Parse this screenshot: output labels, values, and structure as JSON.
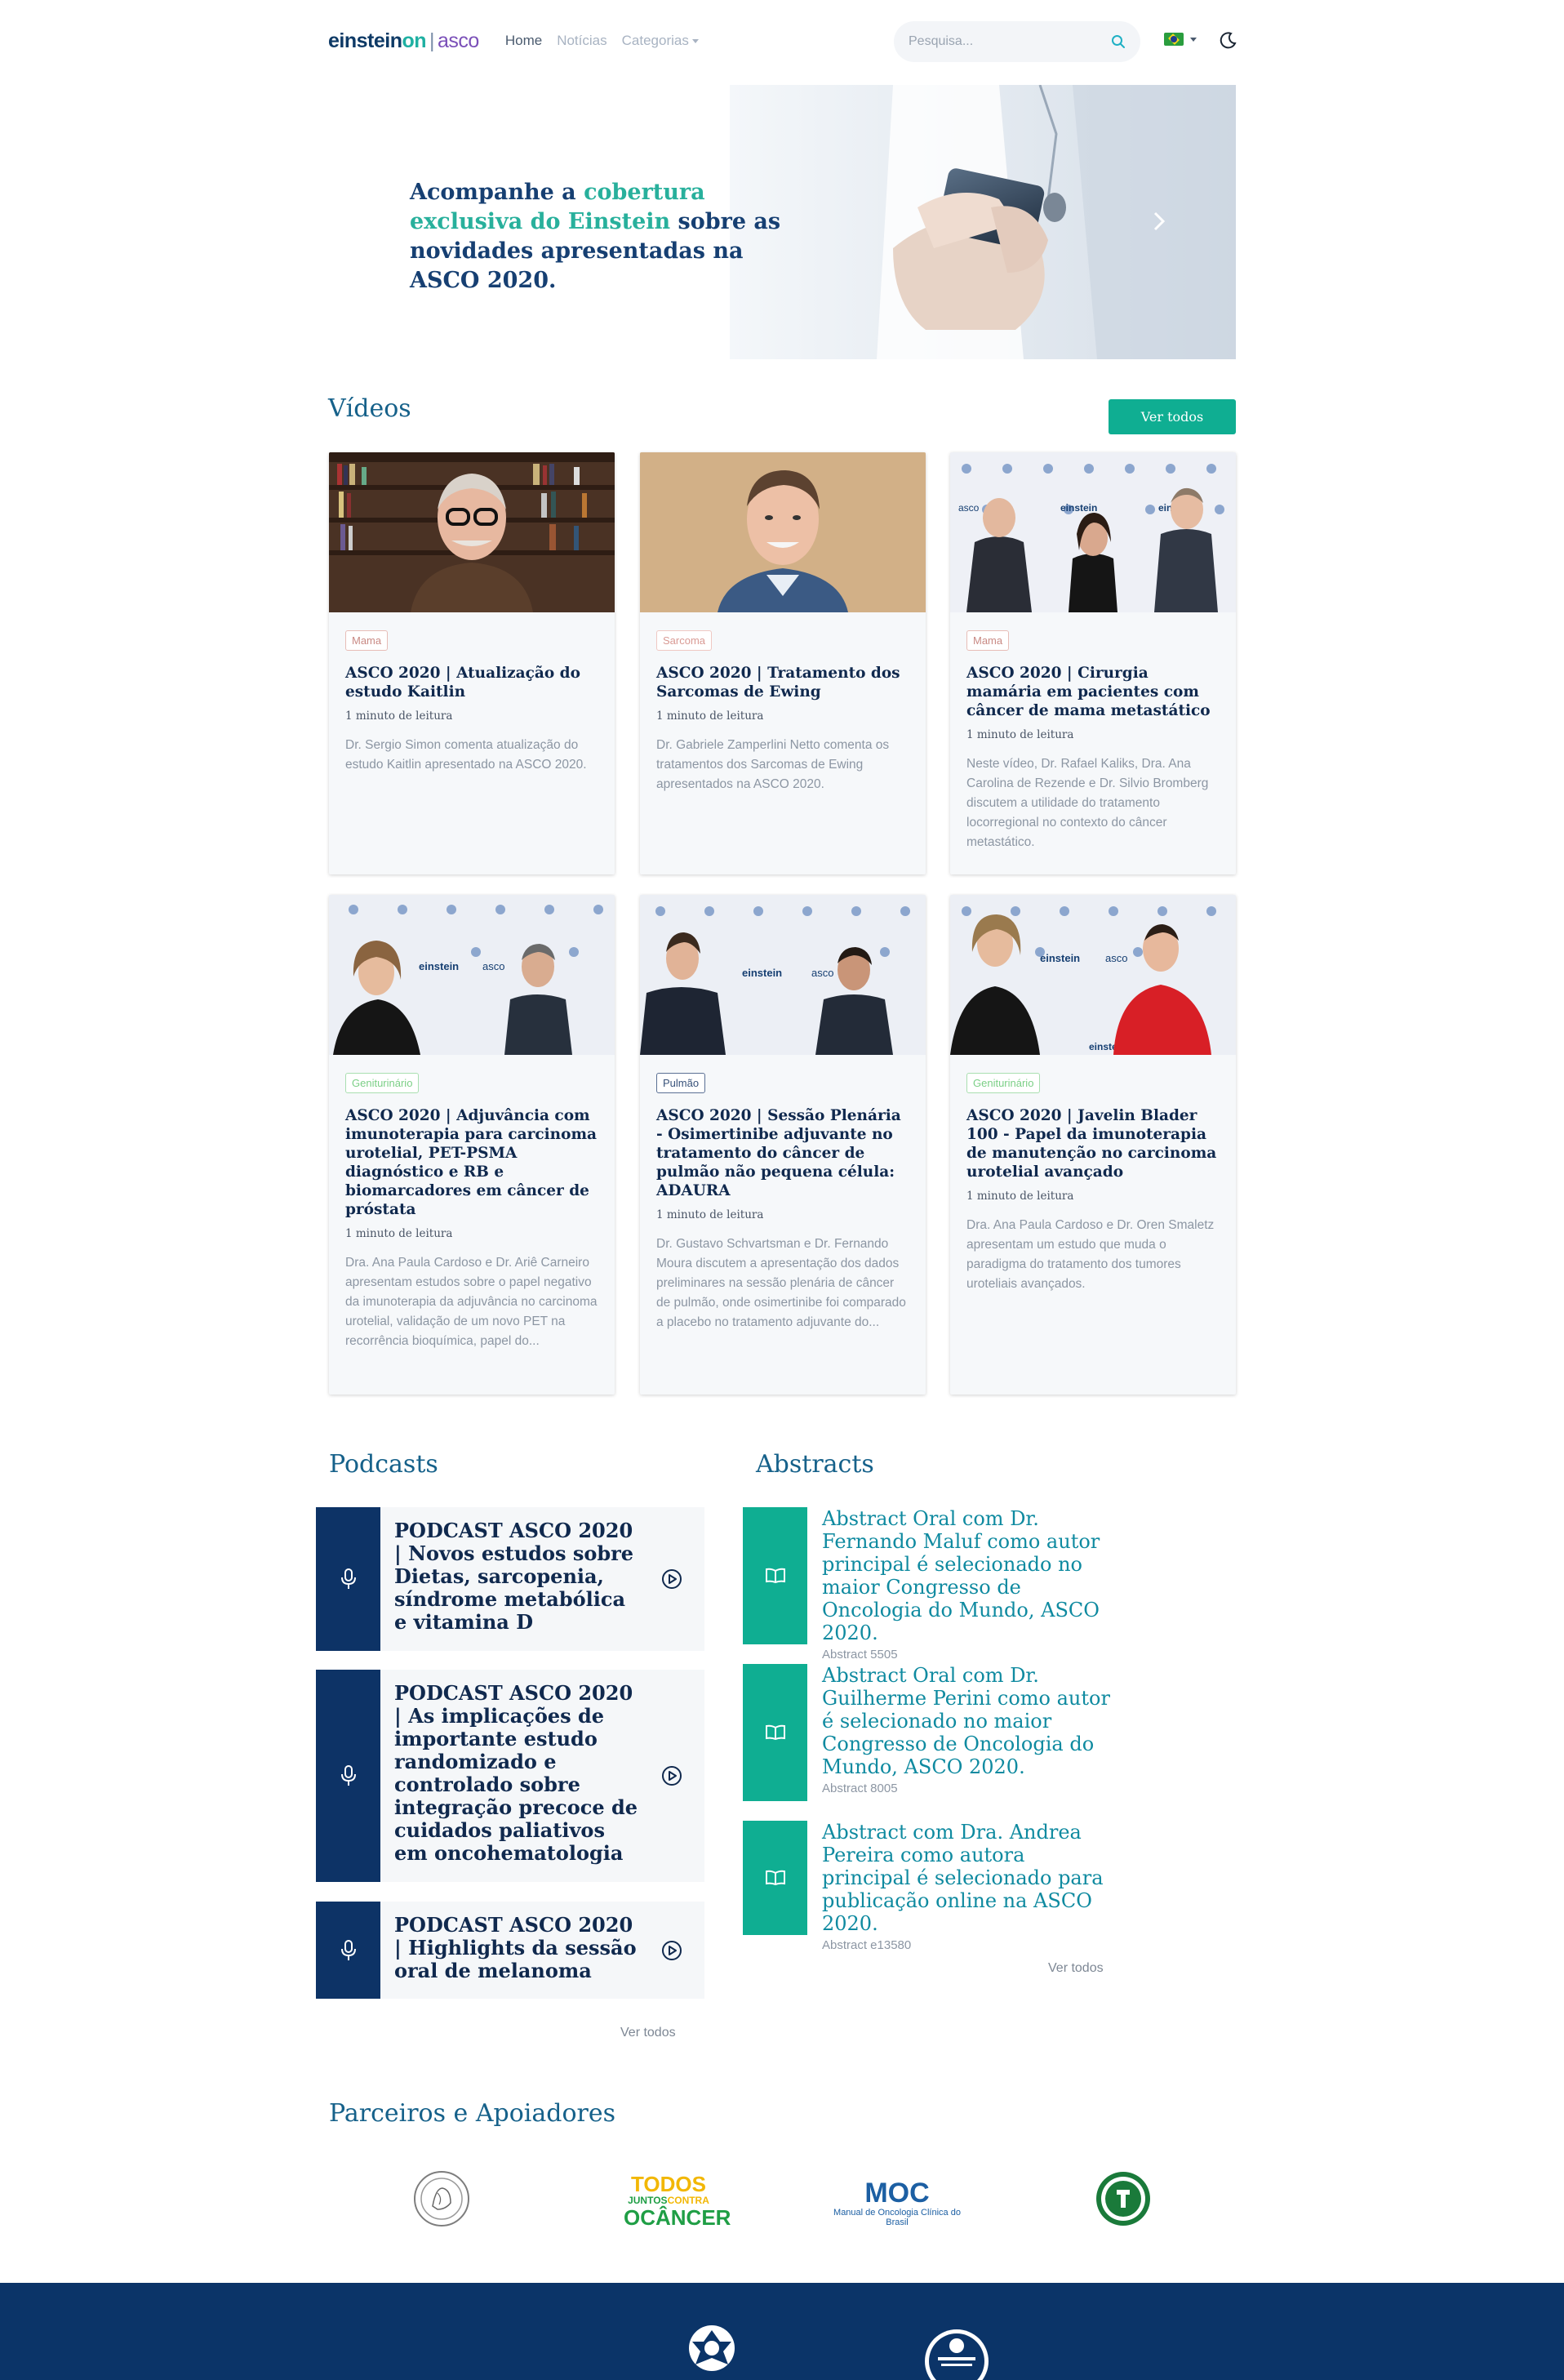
{
  "nav": {
    "logo": {
      "part1": "einstein",
      "part2": "on",
      "separator": "|",
      "part3": "asco"
    },
    "links": [
      "Home",
      "Notícias",
      "Categorias"
    ],
    "search_placeholder": "Pesquisa...",
    "language_icon": "brazil-flag-icon",
    "theme_icon": "moon-icon"
  },
  "hero": {
    "text_before": "Acompanhe a ",
    "text_highlight": "cobertura exclusiva do Einstein",
    "text_after": " sobre as novidades apresentadas na ASCO 2020."
  },
  "videos": {
    "title": "Vídeos",
    "see_all": "Ver todos",
    "items": [
      {
        "tag": "Mama",
        "title": "ASCO 2020 | Atualização do estudo Kaitlin",
        "read": "1 minuto de leitura",
        "desc": "Dr. Sergio Simon comenta atualização do estudo Kaitlin apresentado na ASCO 2020."
      },
      {
        "tag": "Sarcoma",
        "title": "ASCO 2020 | Tratamento dos Sarcomas de Ewing",
        "read": "1 minuto de leitura",
        "desc": "Dr. Gabriele Zamperlini Netto comenta os tratamentos dos Sarcomas de Ewing apresentados na ASCO 2020."
      },
      {
        "tag": "Mama",
        "title": "ASCO 2020 | Cirurgia mamária em pacientes com câncer de mama metastático",
        "read": "1 minuto de leitura",
        "desc": "Neste vídeo, Dr. Rafael Kaliks, Dra. Ana Carolina de Rezende e Dr. Silvio Bromberg discutem a utilidade do tratamento locorregional no contexto do câncer metastático."
      },
      {
        "tag": "Geniturinário",
        "title": "ASCO 2020 | Adjuvância com imunoterapia para carcinoma urotelial, PET-PSMA diagnóstico e RB e biomarcadores em câncer de próstata",
        "read": "1 minuto de leitura",
        "desc": "Dra. Ana Paula Cardoso e Dr. Ariê Carneiro apresentam estudos sobre o papel negativo da imunoterapia da adjuvância no carcinoma urotelial, validação de um novo PET na recorrência bioquímica, papel do..."
      },
      {
        "tag": "Pulmão",
        "title": "ASCO 2020 | Sessão Plenária - Osimertinibe adjuvante no tratamento do câncer de pulmão não pequena célula: ADAURA",
        "read": "1 minuto de leitura",
        "desc": "Dr. Gustavo Schvartsman e Dr. Fernando Moura discutem a apresentação dos dados preliminares na sessão plenária de câncer de pulmão, onde osimertinibe foi comparado a placebo no tratamento adjuvante do..."
      },
      {
        "tag": "Geniturinário",
        "title": "ASCO 2020 | Javelin Blader 100 - Papel da imunoterapia de manutenção no carcinoma urotelial avançado",
        "read": "1 minuto de leitura",
        "desc": "Dra. Ana Paula Cardoso e Dr. Oren Smaletz apresentam um estudo que muda o paradigma do tratamento dos tumores uroteliais avançados."
      }
    ],
    "watermark": {
      "part1": "einstein",
      "part2": "on",
      "separator": "|",
      "part3": "asco"
    }
  },
  "podcasts": {
    "title": "Podcasts",
    "items": [
      {
        "title": "PODCAST ASCO 2020 | Novos estudos sobre Dietas, sarcopenia, síndrome metabólica e vitamina D"
      },
      {
        "title": "PODCAST ASCO 2020 | As implicações de importante estudo randomizado e controlado sobre integração precoce de cuidados paliativos em oncohematologia"
      },
      {
        "title": "PODCAST ASCO 2020 | Highlights da sessão oral de melanoma"
      }
    ],
    "see_all": "Ver todos"
  },
  "abstracts": {
    "title": "Abstracts",
    "items": [
      {
        "title": "Abstract Oral com Dr. Fernando Maluf como autor principal é selecionado no maior Congresso de Oncologia do Mundo, ASCO 2020.",
        "number": "Abstract 5505"
      },
      {
        "title": "Abstract Oral com Dr. Guilherme Perini como autor é selecionado no maior Congresso de Oncologia do Mundo, ASCO 2020.",
        "number": "Abstract 8005"
      },
      {
        "title": "Abstract com Dra. Andrea Pereira como autora principal é selecionado para publicação online na ASCO 2020.",
        "number": "Abstract e13580"
      }
    ],
    "see_all": "Ver todos"
  },
  "partners": {
    "title": "Parceiros e Apoiadores",
    "logos": [
      {
        "name": "society-seal-logo"
      },
      {
        "name": "todos-juntos-contra-o-cancer-logo",
        "line1": "TODOS",
        "line2a": "JUNTOS",
        "line2b": "CONTRA",
        "line3": "OCÂNCER"
      },
      {
        "name": "moc-logo",
        "line1": "MOC",
        "line2": "Manual de Oncologia Clínica do Brasil"
      },
      {
        "name": "green-seal-logo"
      }
    ]
  },
  "footer": {
    "logos": [
      "einstein-logo",
      "rede-einstein-oncologia-logo"
    ]
  },
  "colors": {
    "navy": "#0d3366",
    "teal": "#0fae92",
    "title_blue": "#16618a",
    "abstract_blue": "#0f8aa0"
  }
}
